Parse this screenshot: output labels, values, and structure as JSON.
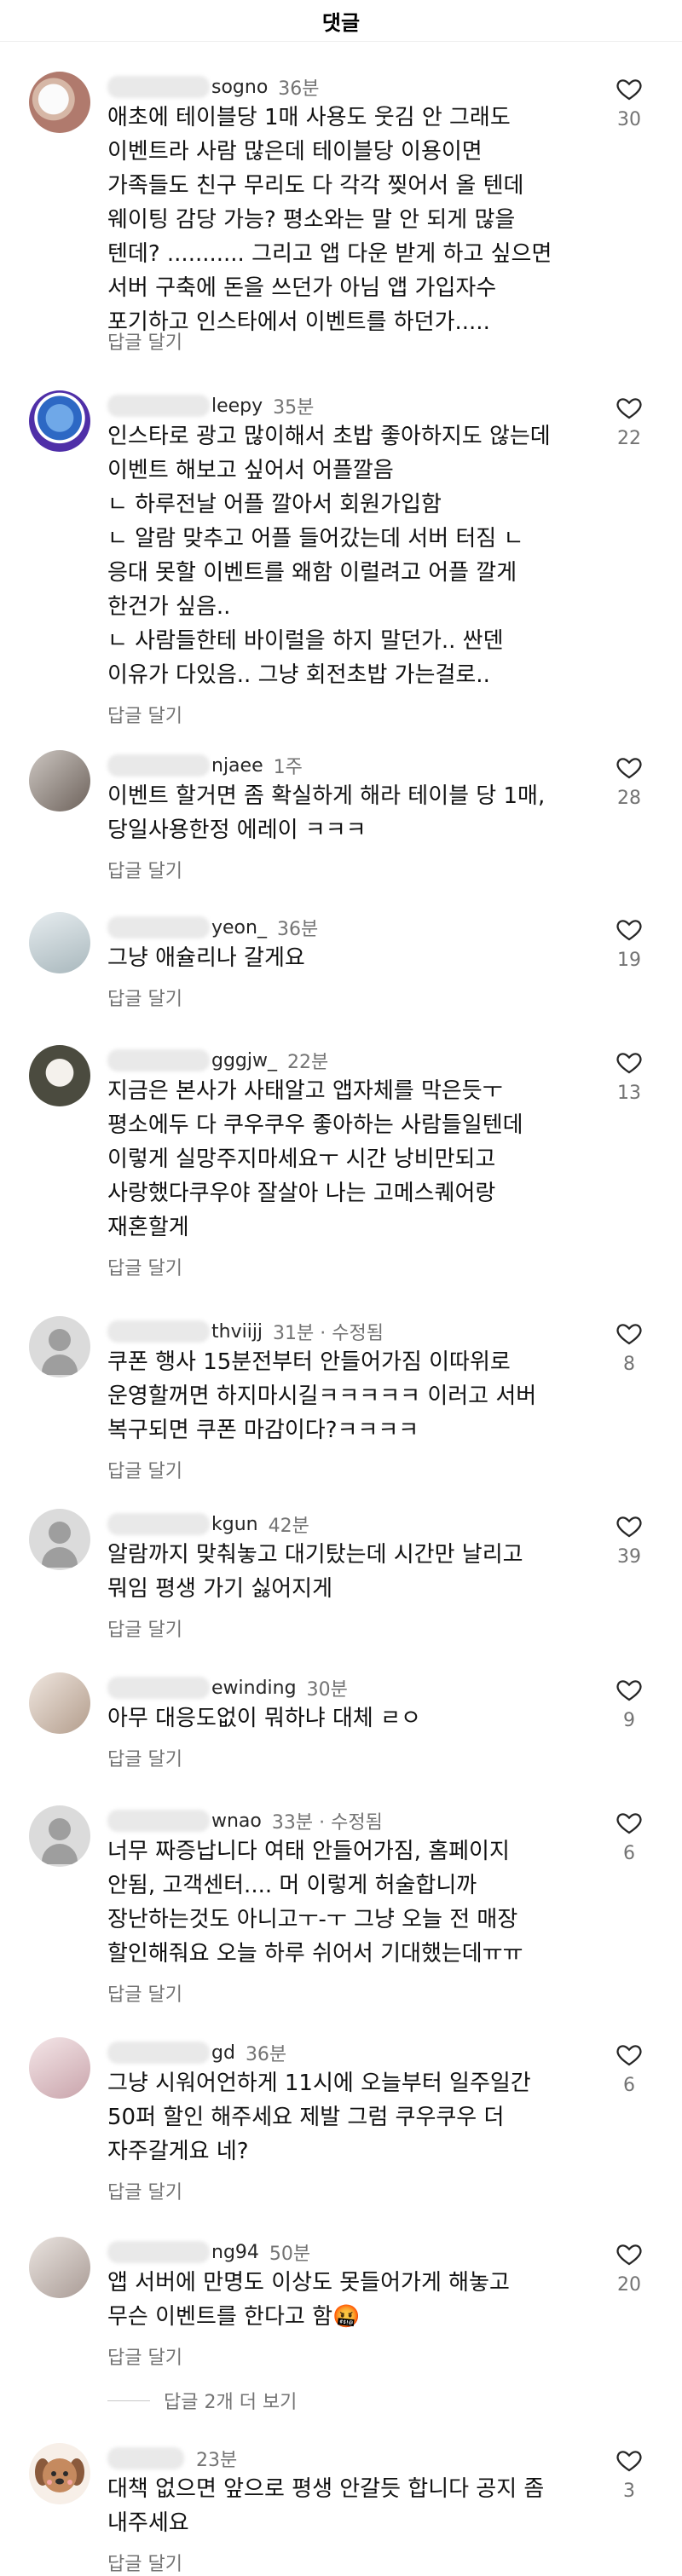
{
  "header": {
    "title": "댓글"
  },
  "comments": [
    {
      "username": "sogno",
      "time": "36분",
      "text": "애초에 테이블당 1매 사용도 웃김 안 그래도\n이벤트라 사람 많은데 테이블당 이용이면\n가족들도 친구 무리도 다 각각 찢어서 올 텐데\n웨이팅 감당 가능? 평소와는 말 안 되게 많을\n텐데? ........... 그리고 앱 다운 받게 하고 싶으면\n서버 구축에 돈을 쓰던가 아님 앱 가입자수\n포기하고 인스타에서 이벤트를 하던가.....",
      "reply": "답글 달기",
      "likes": "30"
    },
    {
      "username": "leepy",
      "time": "35분",
      "text": "인스타로 광고 많이해서 초밥 좋아하지도 않는데\n이벤트 해보고 싶어서 어플깔음\nㄴ 하루전날 어플 깔아서 회원가입함\nㄴ 알람 맞추고 어플 들어갔는데 서버 터짐  ㄴ\n응대 못할 이벤트를 왜함 이럴려고 어플 깔게\n한건가 싶음..\nㄴ 사람들한테 바이럴을 하지 말던가.. 싼덴\n이유가 다있음.. 그냥 회전초밥 가는걸로..",
      "reply": "답글 달기",
      "likes": "22"
    },
    {
      "username": "njaee",
      "time": "1주",
      "text": "이벤트 할거면 좀 확실하게 해라 테이블 당 1매,\n당일사용한정 에레이 ㅋㅋㅋ",
      "reply": "답글 달기",
      "likes": "28"
    },
    {
      "username": "yeon_",
      "time": "36분",
      "text": "그냥 애슐리나 갈게요",
      "reply": "답글 달기",
      "likes": "19"
    },
    {
      "username": "gggjw_",
      "time": "22분",
      "text": "지금은 본사가 사태알고 앱자체를 막은듯ㅜ\n평소에두 다 쿠우쿠우 좋아하는 사람들일텐데\n이렇게 실망주지마세요ㅜ 시간 낭비만되고\n사랑했다쿠우야 잘살아 나는 고메스퀘어랑\n재혼할게",
      "reply": "답글 달기",
      "likes": "13"
    },
    {
      "username": "thviijj",
      "time": "31분 · 수정됨",
      "text": "쿠폰 행사 15분전부터 안들어가짐 이따위로\n운영할꺼면 하지마시길ㅋㅋㅋㅋㅋ 이러고 서버\n복구되면 쿠폰 마감이다?ㅋㅋㅋㅋ",
      "reply": "답글 달기",
      "likes": "8"
    },
    {
      "username": "kgun",
      "time": "42분",
      "text": "알람까지 맞춰놓고 대기탔는데 시간만 날리고\n뭐임 평생 가기 싫어지게",
      "reply": "답글 달기",
      "likes": "39"
    },
    {
      "username": "ewinding",
      "time": "30분",
      "text": "아무 대응도없이 뭐하냐 대체 ㄹㅇ",
      "reply": "답글 달기",
      "likes": "9"
    },
    {
      "username": "wnao",
      "time": "33분 · 수정됨",
      "text": "너무 짜증납니다 여태 안들어가짐, 홈페이지\n안됨, 고객센터.... 머 이렇게 허술합니까\n장난하는것도 아니고ㅜ-ㅜ 그냥 오늘 전 매장\n할인해줘요 오늘 하루 쉬어서 기대했는데ㅠㅠ",
      "reply": "답글 달기",
      "likes": "6"
    },
    {
      "username": "gd",
      "time": "36분",
      "text": "그냥 시워어언하게 11시에 오늘부터 일주일간\n50퍼 할인 해주세요 제발 그럼 쿠우쿠우 더\n자주갈게요 네?",
      "reply": "답글 달기",
      "likes": "6"
    },
    {
      "username": "ng94",
      "time": "50분",
      "text": "앱 서버에 만명도 이상도 못들어가게 해놓고\n무슨 이벤트를 한다고 함🤬",
      "reply": "답글 달기",
      "likes": "20"
    },
    {
      "username": "",
      "time": "23분",
      "text": "대책 없으면 앞으로 평생 안갈듯 합니다 공지 좀\n내주세요",
      "reply": "답글 달기",
      "likes": "3"
    }
  ],
  "more_replies": "답글 2개 더 보기"
}
